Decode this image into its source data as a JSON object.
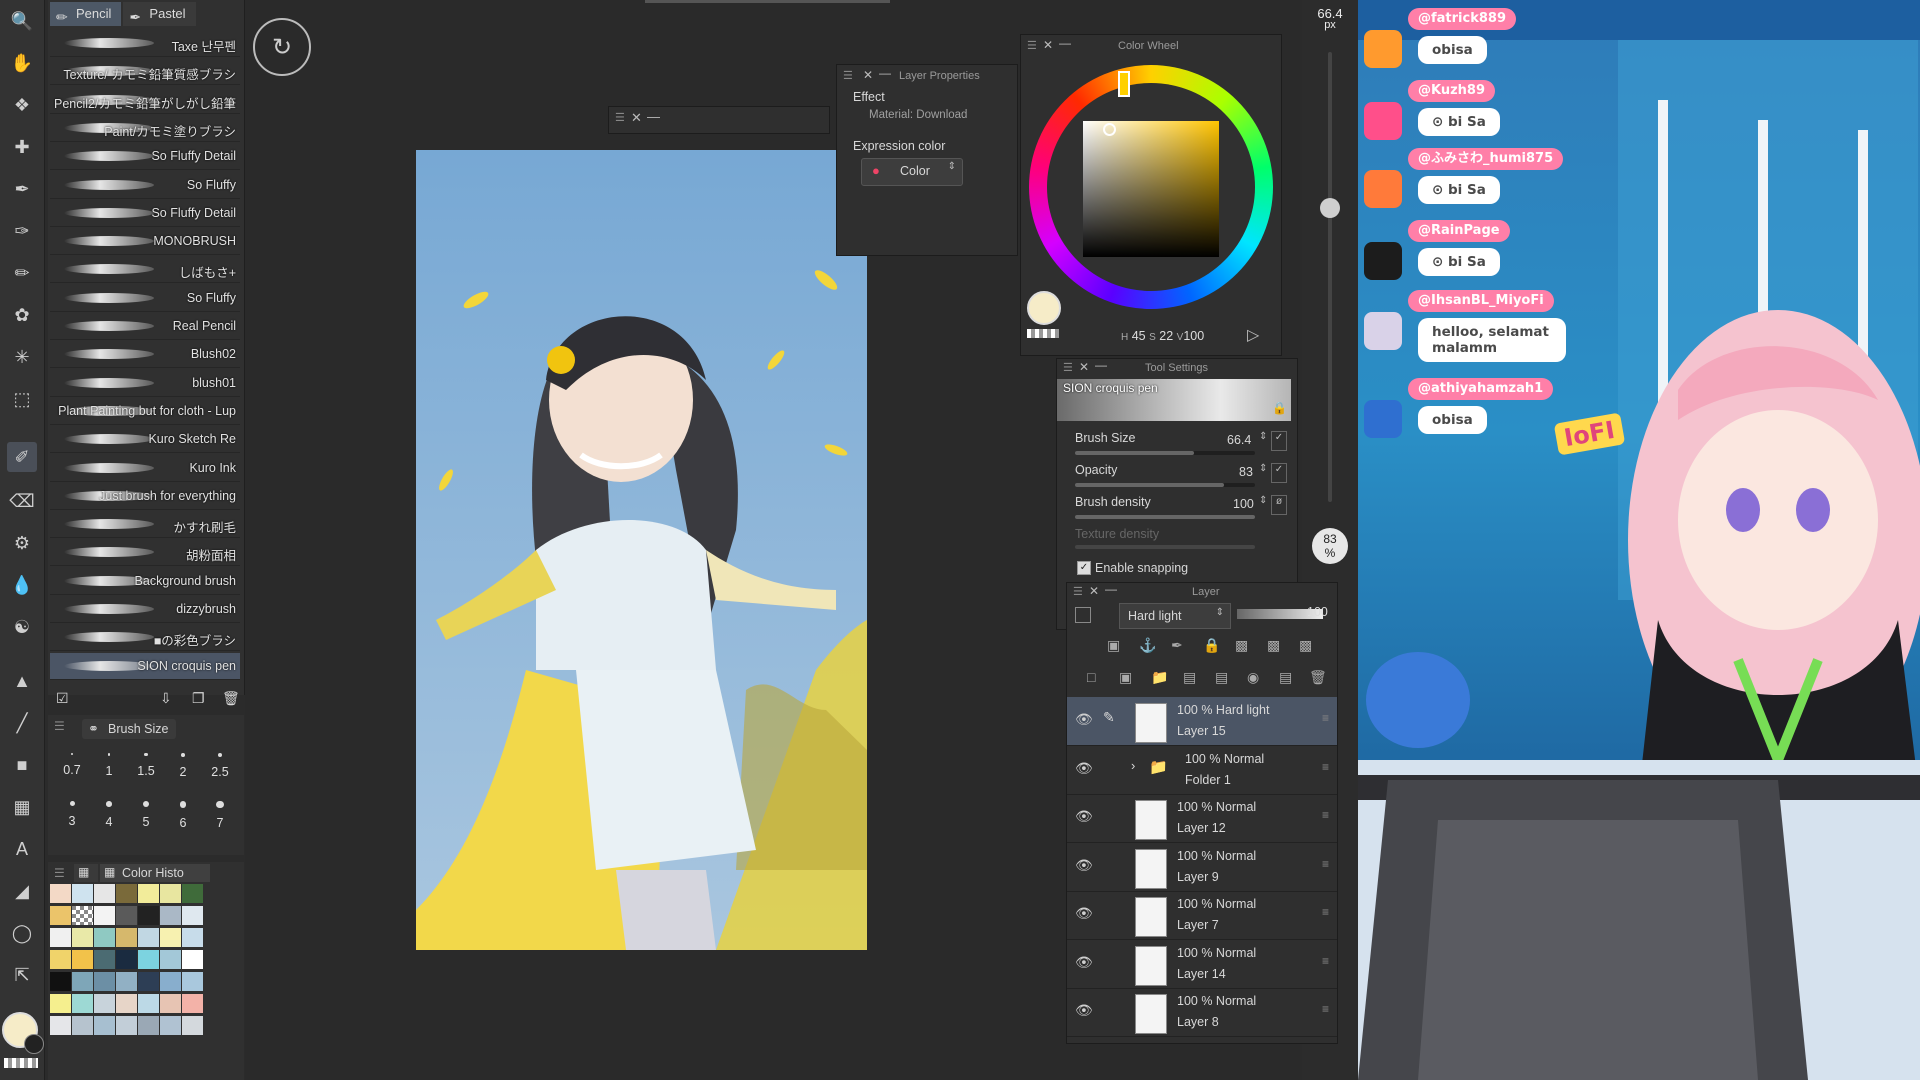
{
  "brush_tabs": [
    {
      "label": "Pencil",
      "icon": "pencil-icon",
      "active": true
    },
    {
      "label": "Pastel",
      "icon": "pastel-icon",
      "active": false
    }
  ],
  "brushes": [
    "Taxe 난무펜",
    "Texture/ カモミ鉛筆質感ブラシ",
    "Pencil2/カモミ鉛筆がしがし鉛筆",
    "Paint/カモミ塗りブラシ",
    "So Fluffy Detail",
    "So Fluffy",
    "So Fluffy Detail",
    "MONOBRUSH",
    "しばもさ+",
    "So Fluffy",
    "Real Pencil",
    "Blush02",
    "blush01",
    "Plant Painting but for cloth - Lup",
    "Kuro Sketch Re",
    "Kuro Ink",
    "Just brush for everything",
    "かすれ刷毛",
    "胡粉面相",
    "Background brush",
    "dizzybrush",
    "■の彩色ブラシ",
    "SION croquis pen"
  ],
  "selected_brush": "SION croquis pen",
  "brush_size_panel": {
    "title": "Brush Size",
    "sizes": [
      "0.7",
      "1",
      "1.5",
      "2",
      "2.5",
      "3",
      "4",
      "5",
      "6",
      "7"
    ]
  },
  "color_history_panel": {
    "title": "Color Histo"
  },
  "palette": [
    "#f3d9c6",
    "#cfe3ef",
    "#e6e6e6",
    "#7a6a3a",
    "#f2ec9a",
    "#e8e6a0",
    "#3f6b3a",
    "#ebc46a",
    "#checker",
    "#f3f3f3",
    "#5a5a5a",
    "#222222",
    "#aab8c6",
    "#dfe8ef",
    "#f0f0f0",
    "#e9e9a8",
    "#8fc9c2",
    "#d6b86c",
    "#c1d7e3",
    "#f7f1b0",
    "#c7dcea",
    "#f0d36a",
    "#f2c24a",
    "#4b6b72",
    "#1a2b40",
    "#7cd3e0",
    "#a3c8d8",
    "#ffffff",
    "#111111",
    "#7ea6b8",
    "#6c8fa5",
    "#91b0c4",
    "#2d3e55",
    "#88aecd",
    "#a9c8dd",
    "#f5ef8e",
    "#9dd9d4",
    "#c8d3db",
    "#e7d5c8",
    "#bcd9e6",
    "#e7c4b3",
    "#f3b2a8",
    "#e5e6e9",
    "#b6c3ce",
    "#a7bfd0",
    "#c2ced8",
    "#9aa8b5",
    "#b0c2d2",
    "#d4d9dd"
  ],
  "layer_properties": {
    "title": "Layer Properties",
    "effect_label": "Effect",
    "material_label": "Material: Download",
    "expression_label": "Expression color",
    "expression_value": "Color"
  },
  "color_wheel": {
    "title": "Color Wheel",
    "h": "45",
    "s": "22",
    "v": "100",
    "current_color": "#f6ecc8"
  },
  "tool_settings": {
    "title": "Tool Settings",
    "tool_name": "SION croquis pen",
    "brush_size_label": "Brush Size",
    "brush_size_value": "66.4",
    "opacity_label": "Opacity",
    "opacity_value": "83",
    "density_label": "Brush density",
    "density_value": "100",
    "texture_label": "Texture density",
    "snapping_label": "Enable snapping"
  },
  "size_indicator": {
    "value": "66.4",
    "unit": "px"
  },
  "opacity_indicator": {
    "value": "83",
    "unit": "%"
  },
  "layer_panel": {
    "title": "Layer",
    "blend_mode": "Hard light",
    "opacity": "100",
    "layers": [
      {
        "blend": "100 % Hard light",
        "name": "Layer 15",
        "selected": true,
        "folder": false
      },
      {
        "blend": "100 % Normal",
        "name": "Folder 1",
        "selected": false,
        "folder": true
      },
      {
        "blend": "100 % Normal",
        "name": "Layer 12",
        "selected": false,
        "folder": false
      },
      {
        "blend": "100 % Normal",
        "name": "Layer 9",
        "selected": false,
        "folder": false
      },
      {
        "blend": "100 % Normal",
        "name": "Layer 7",
        "selected": false,
        "folder": false
      },
      {
        "blend": "100 % Normal",
        "name": "Layer 14",
        "selected": false,
        "folder": false
      },
      {
        "blend": "100 % Normal",
        "name": "Layer 8",
        "selected": false,
        "folder": false
      }
    ]
  },
  "chat": [
    {
      "user": "@fatrick889",
      "message": "obisa",
      "avatar_color": "#ff9a2e"
    },
    {
      "user": "@Kuzh89",
      "message": "⊙ bi Sa",
      "avatar_color": "#ff4f8a"
    },
    {
      "user": "@ふみさわ_humi875",
      "message": "⊙ bi Sa",
      "avatar_color": "#ff7a3a"
    },
    {
      "user": "@RainPage",
      "message": "⊙ bi Sa",
      "avatar_color": "#1c1c1c"
    },
    {
      "user": "@IhsanBL_MiyoFi",
      "message": "helloo, selamat malamm",
      "avatar_color": "#d9d2e8"
    },
    {
      "user": "@athiyahamzah1",
      "message": "obisa",
      "avatar_color": "#2f6fd0"
    }
  ],
  "vtuber_badge": "IoFI"
}
